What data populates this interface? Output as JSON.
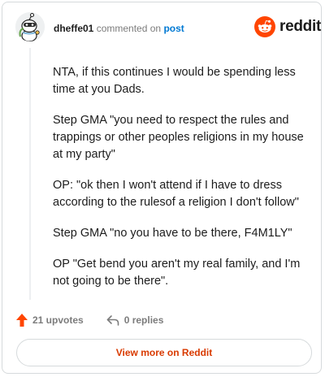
{
  "header": {
    "username": "dheffe01",
    "action_text": "commented on",
    "post_link": "post",
    "logo_text": "reddit",
    "avatar_icon": "snoo-avatar-icon",
    "logo_icon": "reddit-snoo-icon"
  },
  "comment": {
    "paragraphs": [
      "NTA, if this continues I would be spending less time at you Dads.",
      "Step GMA \"you need to respect the rules and trappings or other peoples religions in my house at my party\"",
      "OP: \"ok then I won't attend if I have to dress according to the rulesof a religion I don't follow\"",
      "Step GMA \"no you have to be there, F4M1LY\"",
      "OP \"Get bend you aren't my real family, and I'm not going to be there\"."
    ]
  },
  "footer": {
    "upvotes": "21 upvotes",
    "replies": "0 replies",
    "upvote_icon": "upvote-arrow-icon",
    "reply_icon": "reply-arrow-icon"
  },
  "cta": {
    "label": "View more on Reddit"
  },
  "colors": {
    "reddit_orange": "#ff4500",
    "link_blue": "#0079d3",
    "cta_text": "#d93a00",
    "muted_text": "#7c7c7c"
  }
}
